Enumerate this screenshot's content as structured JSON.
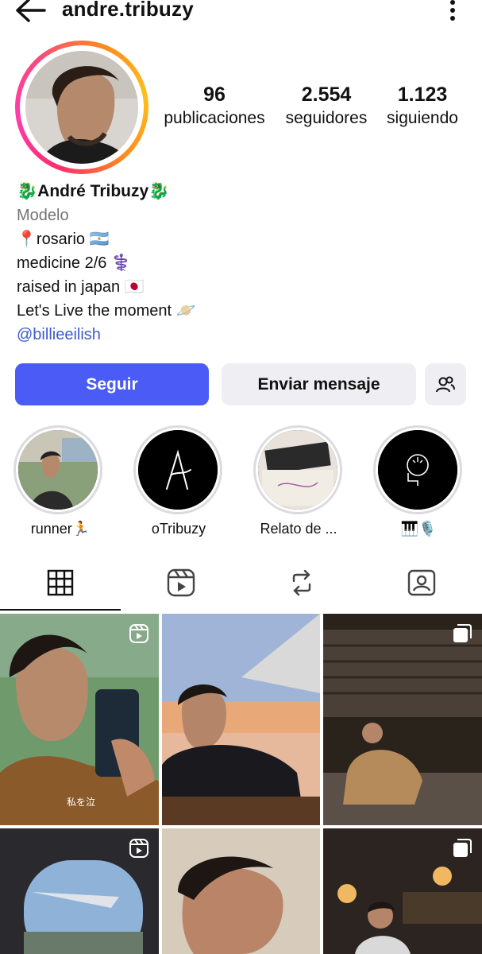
{
  "header": {
    "username": "andre.tribuzy"
  },
  "stats": [
    {
      "value": "96",
      "label": "publicaciones"
    },
    {
      "value": "2.554",
      "label": "seguidores"
    },
    {
      "value": "1.123",
      "label": "siguiendo"
    }
  ],
  "bio": {
    "name": "🐉André Tribuzy🐉",
    "category": "Modelo",
    "lines": [
      "📍rosario 🇦🇷",
      "medicine 2/6 ⚕️",
      "raised in japan 🇯🇵",
      "Let's Live the moment 🪐"
    ],
    "link": "@billieeilish"
  },
  "actions": {
    "follow": "Seguir",
    "message": "Enviar mensaje",
    "suggest_icon": "add-people-icon"
  },
  "highlights": [
    {
      "label": "runner🏃"
    },
    {
      "label": "oTribuzy"
    },
    {
      "label": "Relato de ..."
    },
    {
      "label": "🎹🎙️"
    }
  ],
  "tabs": [
    "grid-icon",
    "reels-icon",
    "reposts-icon",
    "tagged-icon"
  ],
  "grid": [
    {
      "overlay": "私を泣",
      "icon": "reel-icon"
    },
    {
      "icon": ""
    },
    {
      "icon": "carousel-icon"
    },
    {
      "icon": "reel-icon"
    },
    {
      "icon": ""
    },
    {
      "icon": "carousel-icon"
    }
  ],
  "colors": {
    "accent": "#4a5cf5",
    "link": "#3b5ccf",
    "secondary_bg": "#efeff3"
  }
}
